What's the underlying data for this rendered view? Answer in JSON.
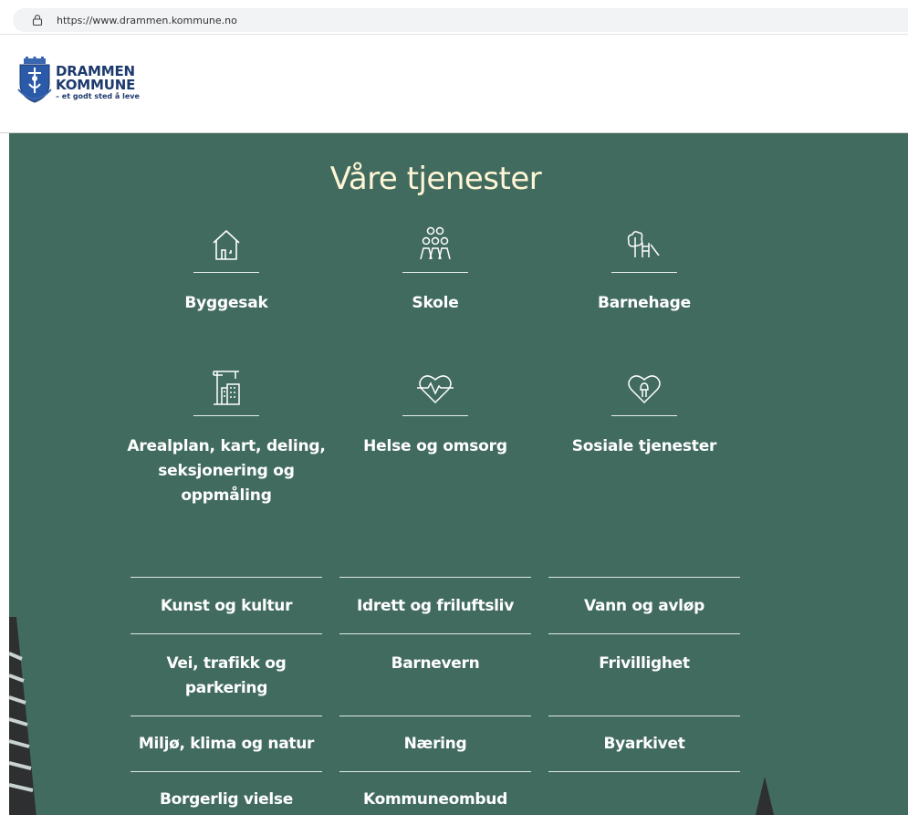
{
  "browser": {
    "url": "https://www.drammen.kommune.no"
  },
  "header": {
    "logo_line1": "DRAMMEN",
    "logo_line2": "KOMMUNE",
    "logo_tagline": "– et godt sted å leve"
  },
  "main": {
    "heading": "Våre tjenester",
    "tiles": [
      {
        "label": "Byggesak",
        "icon": "house-icon"
      },
      {
        "label": "Skole",
        "icon": "people-group-icon"
      },
      {
        "label": "Barnehage",
        "icon": "playground-icon"
      },
      {
        "label": "Arealplan, kart, deling, seksjonering og oppmåling",
        "icon": "city-crane-icon"
      },
      {
        "label": "Helse og omsorg",
        "icon": "heart-pulse-icon"
      },
      {
        "label": "Sosiale tjenester",
        "icon": "heart-hand-icon"
      }
    ],
    "links": [
      "Kunst og kultur",
      "Idrett og friluftsliv",
      "Vann og avløp",
      "Vei, trafikk og parkering",
      "Barnevern",
      "Frivillighet",
      "Miljø, klima og natur",
      "Næring",
      "Byarkivet",
      "Borgerlig vielse",
      "Kommuneombud"
    ]
  },
  "colors": {
    "section_bg": "#426b5f",
    "heading": "#fff6d6",
    "logo_blue": "#1d3a6e"
  }
}
